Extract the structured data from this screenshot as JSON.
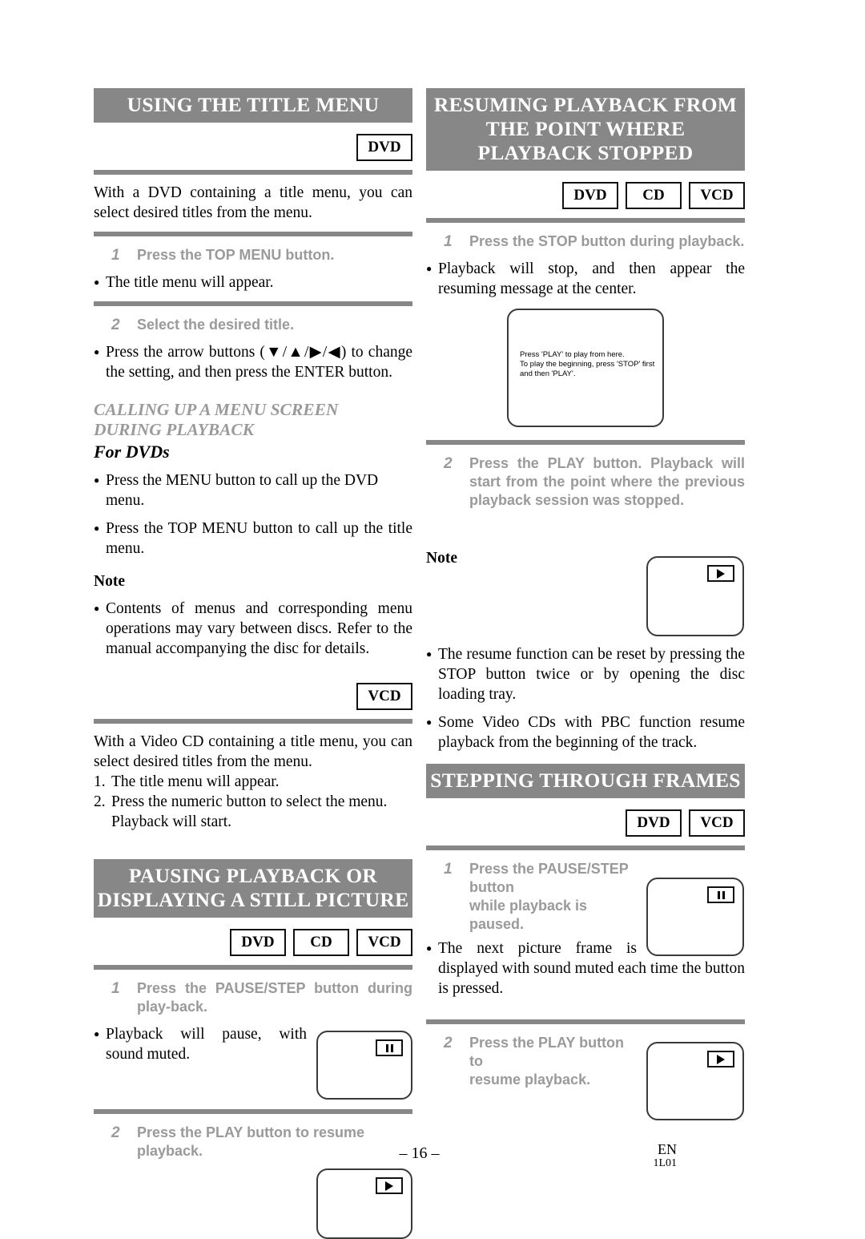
{
  "document": {
    "page_number": "– 16 –",
    "language_code": "EN",
    "revision_code": "1L01"
  },
  "left_column": {
    "section1": {
      "banner_lines": [
        "USING THE TITLE MENU"
      ],
      "badges": [
        "DVD"
      ],
      "intro": "With a DVD containing a title menu, you can select desired titles from the menu.",
      "steps": [
        {
          "number": "1",
          "text": "Press the TOP MENU button.",
          "bullets": [
            "The title menu will appear."
          ]
        },
        {
          "number": "2",
          "text": "Select the desired title.",
          "bullets": [
            "Press the arrow buttons (▼/▲/▶/◀) to change the setting, and then press the ENTER button."
          ]
        }
      ],
      "subheading_line1": "CALLING UP A MENU SCREEN",
      "subheading_line2": "DURING PLAYBACK",
      "subheading2": "For DVDs",
      "dvd_bullets": [
        "Press the MENU button to call up the DVD menu.",
        "Press the TOP MENU button to call up the title menu."
      ],
      "note_label": "Note",
      "note_bullets": [
        "Contents of menus and corresponding menu operations may vary between discs. Refer to the manual accompanying the disc for details."
      ],
      "vcd_badges": [
        "VCD"
      ],
      "vcd_intro": "With a Video CD containing a title menu, you can select desired titles from the menu.",
      "vcd_numlist": [
        {
          "num": "1.",
          "text": "The title menu will appear."
        },
        {
          "num": "2.",
          "text": "Press the numeric button to select the menu. Playback will start."
        }
      ]
    },
    "section2": {
      "banner_lines": [
        "PAUSING PLAYBACK OR",
        "DISPLAYING A STILL PICTURE"
      ],
      "badges": [
        "DVD",
        "CD",
        "VCD"
      ],
      "step1": {
        "number": "1",
        "text": "Press the PAUSE/STEP button during play-back.",
        "bullet": "Playback will pause, with sound muted.",
        "tv_icon": "pause-icon"
      },
      "step2": {
        "number": "2",
        "text": "Press the PLAY button to resume playback.",
        "tv_icon": "play-icon"
      }
    }
  },
  "right_column": {
    "section1": {
      "banner_lines": [
        "RESUMING PLAYBACK FROM",
        "THE POINT WHERE",
        "PLAYBACK STOPPED"
      ],
      "badges": [
        "DVD",
        "CD",
        "VCD"
      ],
      "step1": {
        "number": "1",
        "text": "Press the STOP button during playback.",
        "bullet": "Playback will stop, and then appear the resuming message at the center."
      },
      "tv_message": [
        "Press 'PLAY' to play from here.",
        "To play the beginning, press 'STOP' first",
        "and then 'PLAY'."
      ],
      "step2": {
        "number": "2",
        "text": "Press the PLAY button. Playback will start from the point where the previous playback session was stopped.",
        "tv_icon": "play-icon"
      },
      "note_label": "Note",
      "note_bullets": [
        "The resume function can be reset by pressing the STOP button twice or by opening the disc loading tray.",
        "Some Video CDs with PBC function resume playback from the beginning of the track."
      ]
    },
    "section2": {
      "banner_lines": [
        "STEPPING THROUGH FRAMES"
      ],
      "badges": [
        "DVD",
        "VCD"
      ],
      "step1": {
        "number": "1",
        "text_line1": "Press the PAUSE/STEP button",
        "text_line2": "while playback is paused.",
        "bullet": "The next picture frame is displayed with sound muted each time the button is pressed.",
        "tv_icon": "pause-icon"
      },
      "step2": {
        "number": "2",
        "text_line1": "Press the PLAY button to",
        "text_line2": "resume playback.",
        "tv_icon": "play-icon"
      }
    }
  }
}
